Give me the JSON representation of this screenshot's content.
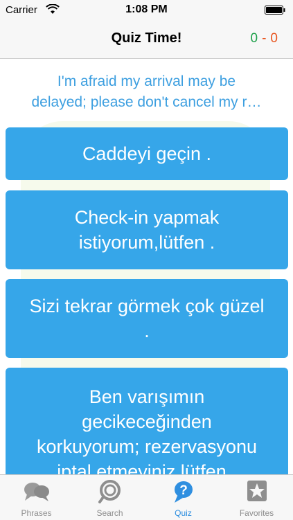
{
  "status_bar": {
    "carrier": "Carrier",
    "time": "1:08 PM",
    "wifi_icon": "wifi-icon",
    "battery_icon": "battery-icon"
  },
  "nav": {
    "title": "Quiz Time!",
    "score_correct": "0",
    "score_separator": "-",
    "score_wrong": "0"
  },
  "quiz": {
    "question_line1": "I'm afraid my arrival may be",
    "question_line2": "delayed; please don't cancel my r…",
    "answers": [
      {
        "lines": [
          "Caddeyi geçin ."
        ]
      },
      {
        "lines": [
          "Check-in yapmak",
          "istiyorum,lütfen ."
        ]
      },
      {
        "lines": [
          "Sizi tekrar görmek çok güzel",
          "."
        ]
      },
      {
        "lines": [
          "Ben varışımın",
          "gecikeceğinden",
          "korkuyorum; rezervasyonu",
          "iptal etmeyiniz lütfen ."
        ]
      }
    ]
  },
  "tabs": [
    {
      "label": "Phrases",
      "icon": "speech-bubbles-icon",
      "active": false
    },
    {
      "label": "Search",
      "icon": "search-icon",
      "active": false
    },
    {
      "label": "Quiz",
      "icon": "question-bubble-icon",
      "active": true
    },
    {
      "label": "Favorites",
      "icon": "star-icon",
      "active": false
    }
  ],
  "colors": {
    "accent": "#36a6e9",
    "question_text": "#3d9fe0",
    "score_correct": "#1ea04a",
    "score_wrong": "#e8541e",
    "tab_active": "#2f8fe0",
    "tab_inactive": "#8e8e8e"
  }
}
